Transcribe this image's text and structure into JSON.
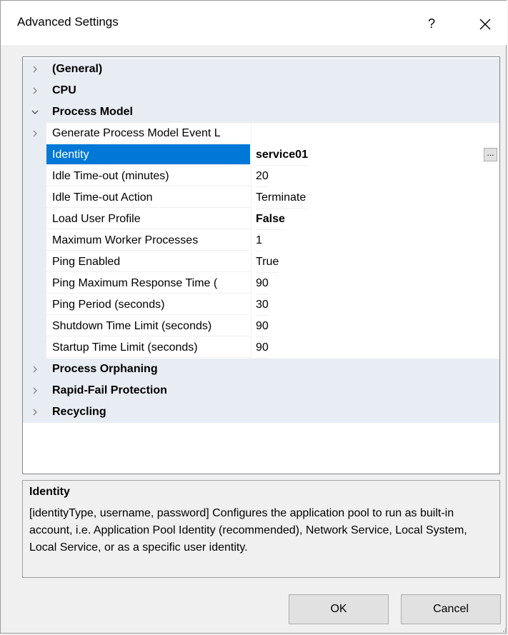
{
  "window": {
    "title": "Advanced Settings",
    "help_label": "?",
    "close_icon": "close-icon"
  },
  "grid": {
    "categories": {
      "general": "(General)",
      "cpu": "CPU",
      "process_model": "Process Model",
      "process_orphaning": "Process Orphaning",
      "rapid_fail": "Rapid-Fail Protection",
      "recycling": "Recycling"
    },
    "properties": [
      {
        "name": "Generate Process Model Event L",
        "value": ""
      },
      {
        "name": "Identity",
        "value": "service01"
      },
      {
        "name": "Idle Time-out (minutes)",
        "value": "20"
      },
      {
        "name": "Idle Time-out Action",
        "value": "Terminate"
      },
      {
        "name": "Load User Profile",
        "value": "False"
      },
      {
        "name": "Maximum Worker Processes",
        "value": "1"
      },
      {
        "name": "Ping Enabled",
        "value": "True"
      },
      {
        "name": "Ping Maximum Response Time (",
        "value": "90"
      },
      {
        "name": "Ping Period (seconds)",
        "value": "30"
      },
      {
        "name": "Shutdown Time Limit (seconds)",
        "value": "90"
      },
      {
        "name": "Startup Time Limit (seconds)",
        "value": "90"
      }
    ],
    "ellipsis_label": "...",
    "selected_color": "#0078d7"
  },
  "description": {
    "title": "Identity",
    "text": "[identityType, username, password] Configures the application pool to run as built-in account, i.e. Application Pool Identity (recommended), Network Service, Local System, Local Service, or as a specific user identity."
  },
  "buttons": {
    "ok": "OK",
    "cancel": "Cancel"
  }
}
